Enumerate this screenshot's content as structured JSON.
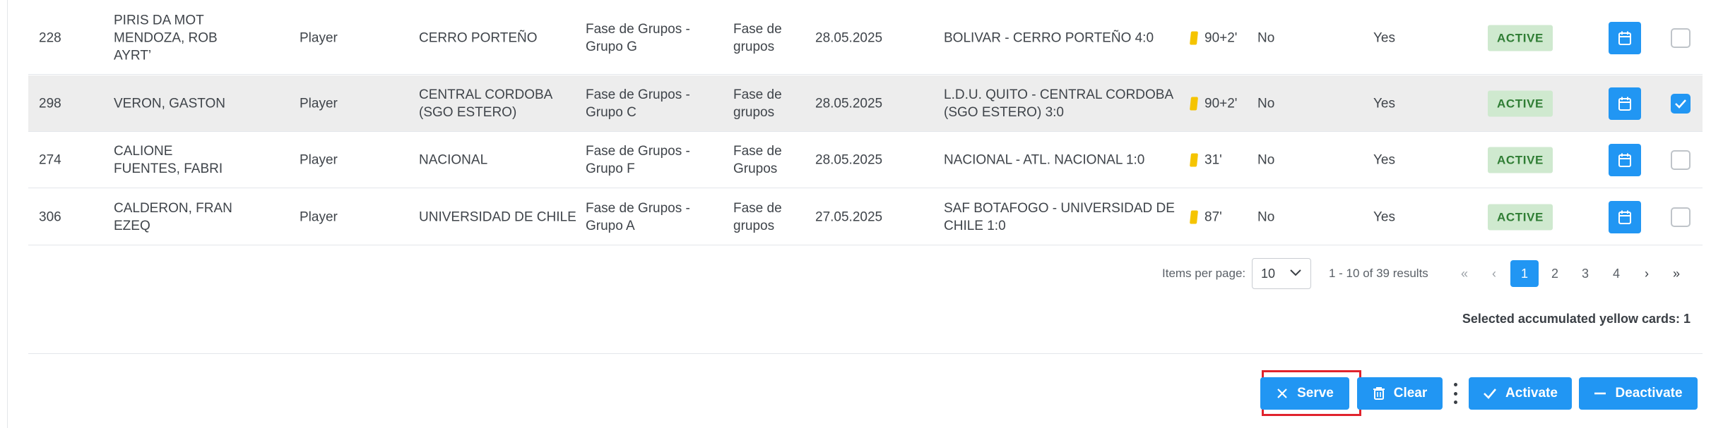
{
  "rows": [
    {
      "id": "228",
      "name": "PIRIS DA MOT MENDOZA, ROB AYRT’",
      "role": "Player",
      "club": "CERRO PORTEÑO",
      "phase": "Fase de Grupos - Grupo G",
      "stage": "Fase de grupos",
      "date": "28.05.2025",
      "match": "BOLIVAR - CERRO PORTEÑO 4:0",
      "minute": "90+2'",
      "suspended": "No",
      "served_flag": "Yes",
      "status": "ACTIVE",
      "checked": false
    },
    {
      "id": "298",
      "name": "VERON, GASTON",
      "role": "Player",
      "club": "CENTRAL CORDOBA (SGO ESTERO)",
      "phase": "Fase de Grupos - Grupo C",
      "stage": "Fase de grupos",
      "date": "28.05.2025",
      "match": "L.D.U. QUITO - CENTRAL CORDOBA (SGO ESTERO) 3:0",
      "minute": "90+2'",
      "suspended": "No",
      "served_flag": "Yes",
      "status": "ACTIVE",
      "checked": true
    },
    {
      "id": "274",
      "name": "CALIONE FUENTES, FABRI",
      "role": "Player",
      "club": "NACIONAL",
      "phase": "Fase de Grupos - Grupo F",
      "stage": "Fase de Grupos",
      "date": "28.05.2025",
      "match": "NACIONAL - ATL. NACIONAL 1:0",
      "minute": "31'",
      "suspended": "No",
      "served_flag": "Yes",
      "status": "ACTIVE",
      "checked": false
    },
    {
      "id": "306",
      "name": "CALDERON, FRAN EZEQ",
      "role": "Player",
      "club": "UNIVERSIDAD DE CHILE",
      "phase": "Fase de Grupos - Grupo A",
      "stage": "Fase de grupos",
      "date": "27.05.2025",
      "match": "SAF BOTAFOGO - UNIVERSIDAD DE CHILE 1:0",
      "minute": "87'",
      "suspended": "No",
      "served_flag": "Yes",
      "status": "ACTIVE",
      "checked": false
    }
  ],
  "pagination": {
    "items_per_page_label": "Items per page:",
    "items_per_page": "10",
    "range": "1 - 10 of 39 results",
    "first": "«",
    "prev": "‹",
    "pages": [
      "1",
      "2",
      "3",
      "4"
    ],
    "next": "›",
    "last": "»"
  },
  "summary": "Selected accumulated yellow cards: 1",
  "actions": {
    "serve": "Serve",
    "clear": "Clear",
    "activate": "Activate",
    "deactivate": "Deactivate"
  },
  "colors": {
    "accent": "#2196f3",
    "status_bg": "#cfe9cf",
    "status_text": "#2f7d34",
    "yellow_card": "#f5c400",
    "highlight": "#e0232d"
  }
}
